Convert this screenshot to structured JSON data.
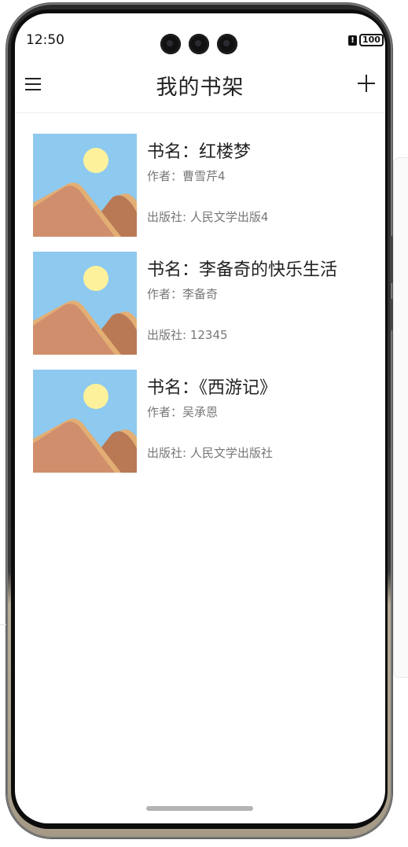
{
  "status_bar": {
    "time": "12:50",
    "battery_level": "100"
  },
  "navbar": {
    "title": "我的书架",
    "menu_icon": "hamburger-menu-icon",
    "add_icon": "plus-icon"
  },
  "books": [
    {
      "title": "书名：红楼梦",
      "author": "作者：曹雪芹4",
      "publisher": "出版社: 人民文学出版4",
      "cover_icon": "landscape-image-icon"
    },
    {
      "title": "书名：李备奇的快乐生活",
      "author": "作者：李备奇",
      "publisher": "出版社: 12345",
      "cover_icon": "landscape-image-icon"
    },
    {
      "title": "书名：《西游记》",
      "author": "作者：吴承恩",
      "publisher": "出版社: 人民文学出版社",
      "cover_icon": "landscape-image-icon"
    }
  ],
  "colors": {
    "sky": "#8ec9ef",
    "sun": "#fdf29b",
    "mountain": "#d08e6c",
    "mountain_back": "#b97955",
    "sand": "#e3ae74"
  }
}
